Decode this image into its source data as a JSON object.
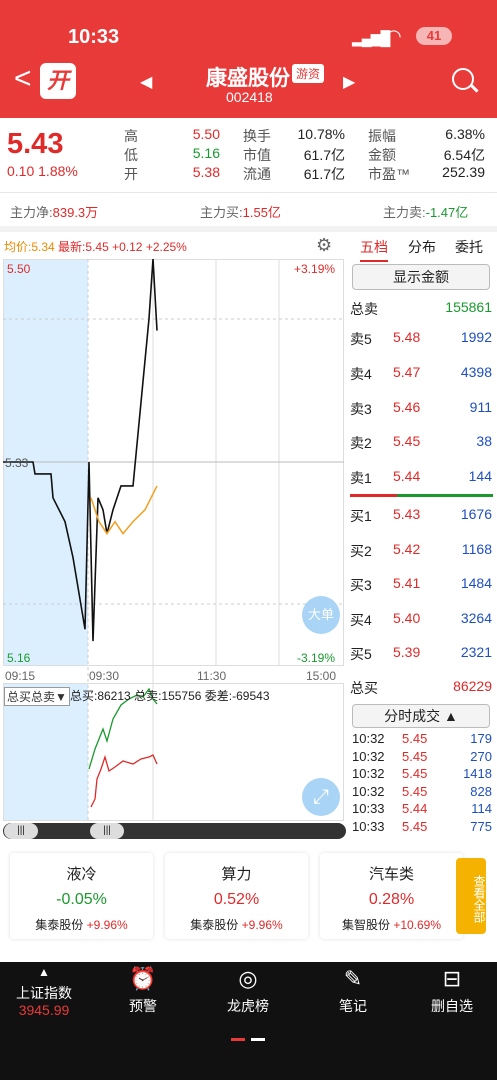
{
  "status": {
    "time": "10:33",
    "battery": "41"
  },
  "header": {
    "name": "康盛股份",
    "tag": "游资",
    "code": "002418",
    "logo": "开"
  },
  "quote": {
    "price": "5.43",
    "change": "0.10",
    "pct": "1.88%",
    "rows": [
      {
        "l1": "高",
        "v1": "5.50",
        "l2": "换手",
        "v2": "10.78%",
        "l3": "振幅",
        "v3": "6.38%"
      },
      {
        "l1": "低",
        "v1": "5.16",
        "l2": "市值",
        "v2": "61.7亿",
        "l3": "金额",
        "v3": "6.54亿"
      },
      {
        "l1": "开",
        "v1": "5.38",
        "l2": "流通",
        "v2": "61.7亿",
        "l3": "市盈™",
        "v3": "252.39"
      }
    ]
  },
  "flows": {
    "net_label": "主力净:",
    "net": "839.3万",
    "buy_label": "主力买:",
    "buy": "1.55亿",
    "sell_label": "主力卖:",
    "sell": "-1.47亿"
  },
  "chart_info": {
    "avg_label": "均价:",
    "avg": "5.34",
    "latest_label": "最新:",
    "latest": "5.45",
    "chg": "+0.12",
    "pct": "+2.25%",
    "ytop": "5.50",
    "ybot": "5.16",
    "pctTop": "+3.19%",
    "pctBot": "-3.19%",
    "t0": "09:15",
    "t1": "09:30",
    "t2": "11:30",
    "t3": "15:00",
    "mid": "5.33",
    "big": "大单",
    "sub_select": "总买总卖▼",
    "sub_buy": "总买:86213",
    "sub_sell": "总卖:155756",
    "sub_diff": "委差:-69543"
  },
  "chart_data": {
    "type": "line",
    "ylim": [
      5.16,
      5.5
    ],
    "series": [
      {
        "name": "最新",
        "values": [
          5.33,
          5.33,
          5.32,
          5.32,
          5.3,
          5.28,
          5.25,
          5.21,
          5.19,
          5.33,
          5.18,
          5.3,
          5.29,
          5.27,
          5.29,
          5.31,
          5.31,
          5.45,
          5.5,
          5.44
        ]
      },
      {
        "name": "均价",
        "values": [
          5.3,
          5.28,
          5.27,
          5.28,
          5.27,
          5.28,
          5.29,
          5.31
        ]
      }
    ]
  },
  "panel": {
    "tab1": "五档",
    "tab2": "分布",
    "tab3": "委托",
    "btn": "显示金额",
    "total_sell_label": "总卖",
    "total_sell": "155861",
    "sells": [
      {
        "l": "卖5",
        "p": "5.48",
        "q": "1992"
      },
      {
        "l": "卖4",
        "p": "5.47",
        "q": "4398"
      },
      {
        "l": "卖3",
        "p": "5.46",
        "q": "911"
      },
      {
        "l": "卖2",
        "p": "5.45",
        "q": "38"
      },
      {
        "l": "卖1",
        "p": "5.44",
        "q": "144"
      }
    ],
    "buys": [
      {
        "l": "买1",
        "p": "5.43",
        "q": "1676"
      },
      {
        "l": "买2",
        "p": "5.42",
        "q": "1168"
      },
      {
        "l": "买3",
        "p": "5.41",
        "q": "1484"
      },
      {
        "l": "买4",
        "p": "5.40",
        "q": "3264"
      },
      {
        "l": "买5",
        "p": "5.39",
        "q": "2321"
      }
    ],
    "total_buy_label": "总买",
    "total_buy": "86229",
    "ticks_btn": "分时成交 ▲",
    "ticks": [
      {
        "t": "10:32",
        "p": "5.45",
        "q": "179"
      },
      {
        "t": "10:32",
        "p": "5.45",
        "q": "270"
      },
      {
        "t": "10:32",
        "p": "5.45",
        "q": "1418"
      },
      {
        "t": "10:32",
        "p": "5.45",
        "q": "828"
      },
      {
        "t": "10:33",
        "p": "5.44",
        "q": "114"
      },
      {
        "t": "10:33",
        "p": "5.45",
        "q": "775"
      }
    ]
  },
  "cards": [
    {
      "t": "液冷",
      "v": "-0.05%",
      "s1": "集泰股份",
      "s2": "+9.96%"
    },
    {
      "t": "算力",
      "v": "0.52%",
      "s1": "集泰股份",
      "s2": "+9.96%"
    },
    {
      "t": "汽车类",
      "v": "0.28%",
      "s1": "集智股份",
      "s2": "+10.69%"
    }
  ],
  "more": "查看全部",
  "tabbar": {
    "idx_name": "上证指数",
    "idx_val": "3945.99",
    "i1": "预警",
    "i2": "龙虎榜",
    "i3": "笔记",
    "i4": "删自选"
  }
}
